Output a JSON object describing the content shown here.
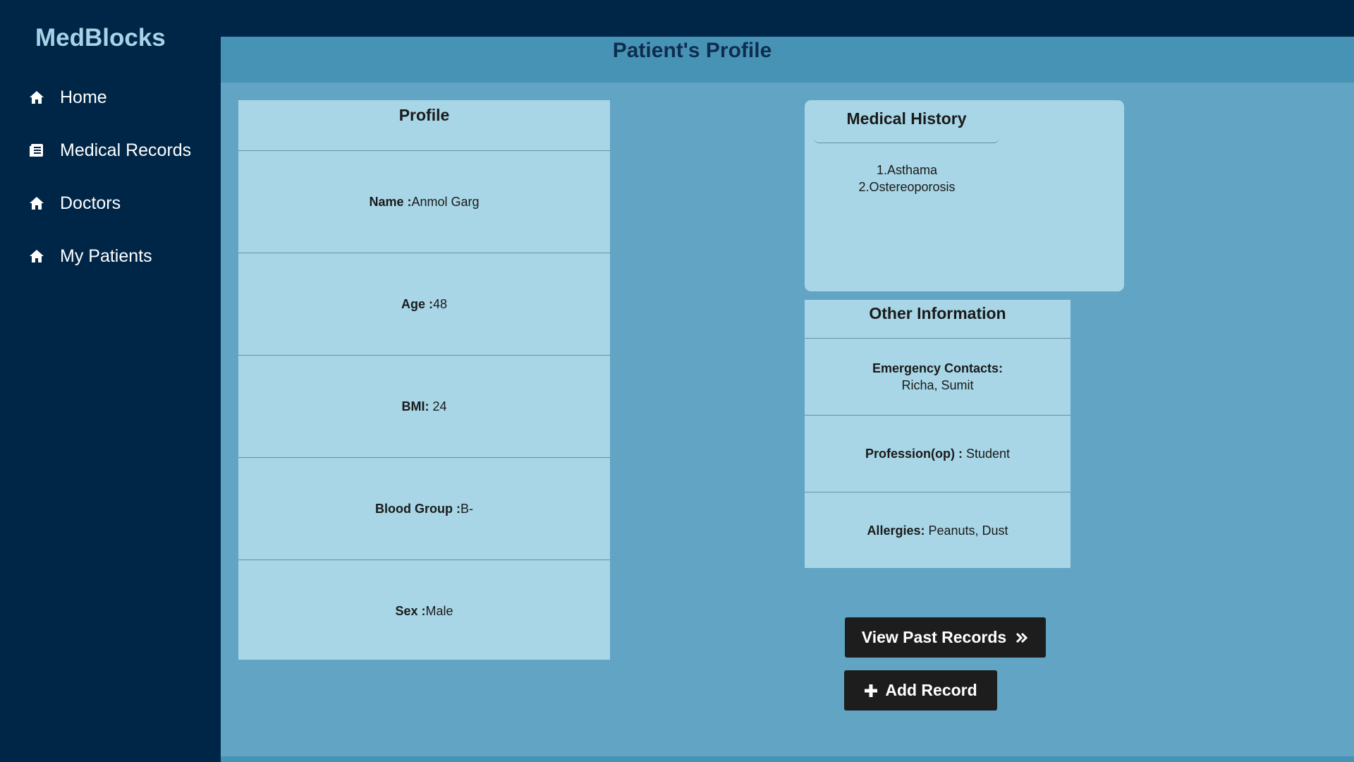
{
  "app": {
    "brand": "MedBlocks"
  },
  "sidebar": {
    "items": [
      {
        "label": "Home",
        "icon": "home-icon"
      },
      {
        "label": "Medical Records",
        "icon": "list-icon"
      },
      {
        "label": "Doctors",
        "icon": "home-icon"
      },
      {
        "label": "My Patients",
        "icon": "home-icon"
      }
    ]
  },
  "page": {
    "title": "Patient's Profile"
  },
  "profile": {
    "heading": "Profile",
    "fields": [
      {
        "label": "Name :",
        "value": "Anmol Garg"
      },
      {
        "label": "Age :",
        "value": "48"
      },
      {
        "label": "BMI:",
        "value": " 24"
      },
      {
        "label": "Blood Group :",
        "value": "B-"
      },
      {
        "label": "Sex :",
        "value": "Male"
      }
    ]
  },
  "medical_history": {
    "heading": "Medical History",
    "items": [
      "1.Asthama",
      "2.Ostereoporosis"
    ]
  },
  "other_info": {
    "heading": "Other Information",
    "emergency_label": "Emergency Contacts:",
    "emergency_value": "Richa, Sumit",
    "profession_label": "Profession(op) :",
    "profession_value": " Student",
    "allergies_label": "Allergies:",
    "allergies_value": " Peanuts, Dust"
  },
  "actions": {
    "view_past_label": "View Past Records",
    "add_record_label": "Add Record"
  },
  "colors": {
    "sidebar_bg": "#002647",
    "main_bg": "#62a4c3",
    "header_bg": "#4793b5",
    "card_bg": "#a8d6e6",
    "brand": "#a7d3e8",
    "button_bg": "#1d1d1d"
  }
}
